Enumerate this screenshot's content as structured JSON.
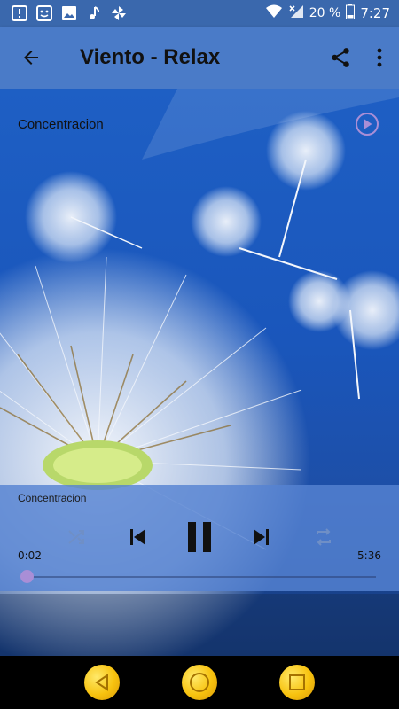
{
  "status_bar": {
    "battery_percent": "20 %",
    "time": "7:27",
    "left_icons": [
      "notification-icon",
      "face-icon",
      "image-icon",
      "music-note-icon",
      "pinwheel-icon"
    ],
    "right_icons": [
      "wifi-icon",
      "signal-icon",
      "battery-icon"
    ]
  },
  "app_bar": {
    "title": "Viento - Relax",
    "back_icon": "arrow-back-icon",
    "share_icon": "share-icon",
    "more_icon": "more-vert-icon"
  },
  "track_list": [
    {
      "label": "Concentracion",
      "icon": "play-circle-icon"
    }
  ],
  "player": {
    "now_playing": "Concentracion",
    "elapsed": "0:02",
    "duration": "5:36",
    "progress_fraction": 0.006,
    "controls": [
      "shuffle-icon",
      "skip-previous-icon",
      "pause-icon",
      "skip-next-icon",
      "repeat-icon"
    ]
  },
  "colors": {
    "app_bar": "#4a7bc8",
    "status_bar": "#3a68ad",
    "accent": "#a98ed6",
    "nav_button": "#f7c20e"
  }
}
